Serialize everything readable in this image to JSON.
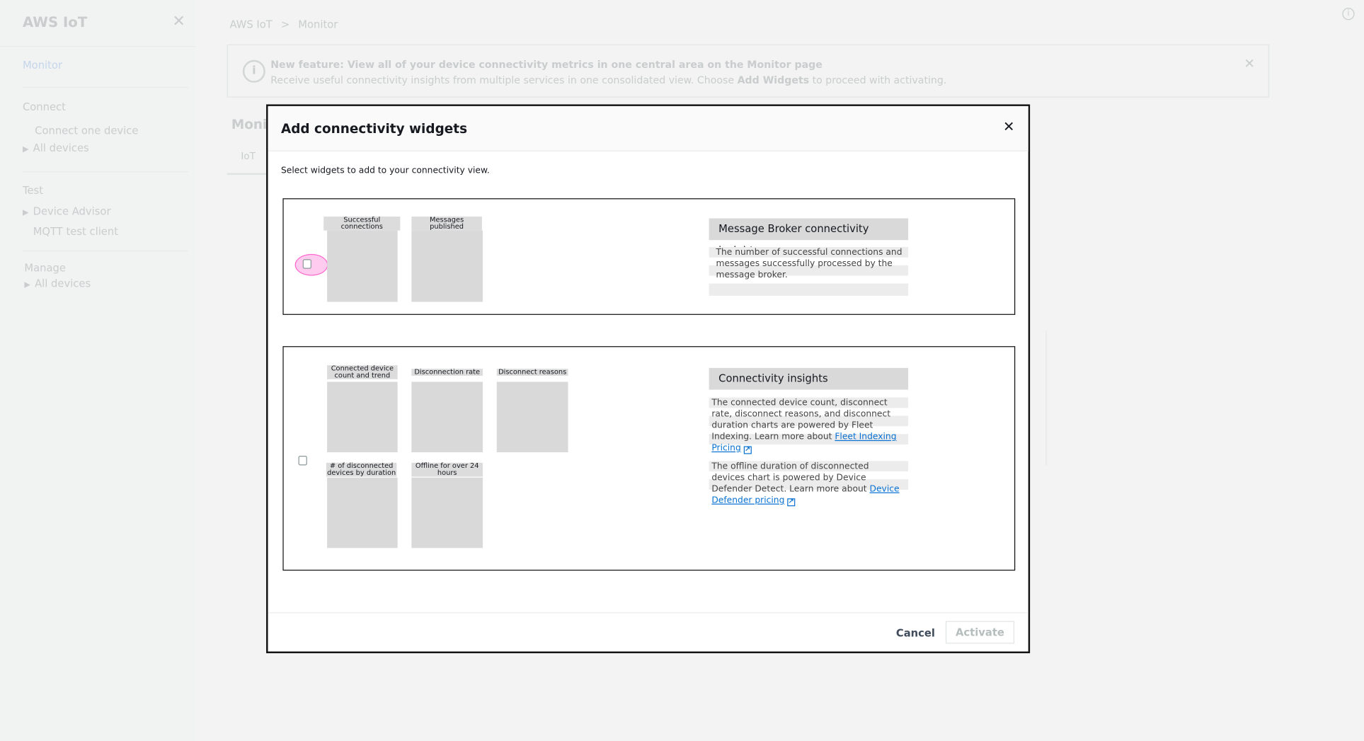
{
  "sidebar": {
    "title": "AWS IoT",
    "close_icon": "close-icon",
    "items": [
      {
        "label": "Monitor"
      },
      {
        "label": "Connect"
      },
      {
        "label": "Connect one device"
      },
      {
        "label": "All devices"
      },
      {
        "label": "Test"
      },
      {
        "label": "Device Advisor"
      },
      {
        "label": "MQTT test client"
      },
      {
        "label": "Manage"
      },
      {
        "label": "All devices"
      }
    ]
  },
  "breadcrumb": {
    "root": "AWS IoT",
    "sep": ">",
    "current": "Monitor"
  },
  "banner": {
    "title": "New feature: View all of your device connectivity metrics in one central area on the Monitor page",
    "body_pre": "Receive useful connectivity insights from multiple services in one consolidated view. Choose ",
    "body_bold": "Add Widgets",
    "body_post": " to proceed with activating."
  },
  "page": {
    "title_partial": "Monit",
    "tab_partial": "IoT"
  },
  "dialog": {
    "title": "Add connectivity widgets",
    "instructions": "Select widgets to add to your connectivity view.",
    "groups": [
      {
        "widgets": [
          "Successful connections",
          "Messages published"
        ],
        "info_title": "Message Broker connectivity insights",
        "info_text": "The number of successful connections and messages successfully processed by the message broker."
      },
      {
        "widgets": [
          "Connected device count and trend",
          "Disconnection rate",
          "Disconnect reasons",
          "# of disconnected devices by duration",
          "Offline for over 24 hours"
        ],
        "info_title": "Connectivity insights",
        "info_text1": "The connected device count, disconnect rate, disconnect reasons, and disconnect duration charts are powered by Fleet Indexing. Learn more about ",
        "info_link1": "Fleet Indexing Pricing",
        "info_text2": "The offline duration of disconnected devices chart is powered by Device Defender Detect. Learn more about ",
        "info_link2": "Device Defender pricing"
      }
    ],
    "cancel_label": "Cancel",
    "activate_label": "Activate"
  },
  "colors": {
    "link": "#0972d3",
    "highlight": "#ff66cc"
  }
}
